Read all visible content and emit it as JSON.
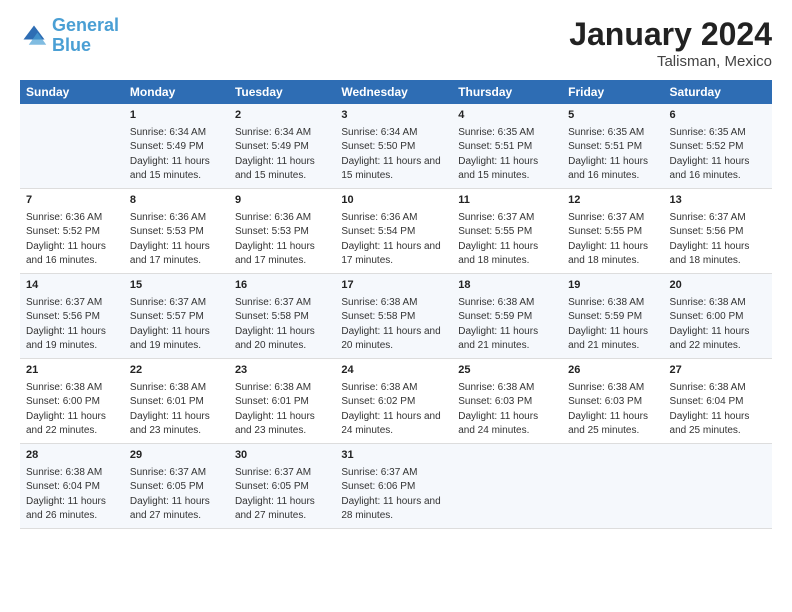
{
  "logo": {
    "line1": "General",
    "line2": "Blue"
  },
  "title": "January 2024",
  "subtitle": "Talisman, Mexico",
  "headers": [
    "Sunday",
    "Monday",
    "Tuesday",
    "Wednesday",
    "Thursday",
    "Friday",
    "Saturday"
  ],
  "rows": [
    [
      {
        "day": "",
        "sunrise": "",
        "sunset": "",
        "daylight": ""
      },
      {
        "day": "1",
        "sunrise": "Sunrise: 6:34 AM",
        "sunset": "Sunset: 5:49 PM",
        "daylight": "Daylight: 11 hours and 15 minutes."
      },
      {
        "day": "2",
        "sunrise": "Sunrise: 6:34 AM",
        "sunset": "Sunset: 5:49 PM",
        "daylight": "Daylight: 11 hours and 15 minutes."
      },
      {
        "day": "3",
        "sunrise": "Sunrise: 6:34 AM",
        "sunset": "Sunset: 5:50 PM",
        "daylight": "Daylight: 11 hours and 15 minutes."
      },
      {
        "day": "4",
        "sunrise": "Sunrise: 6:35 AM",
        "sunset": "Sunset: 5:51 PM",
        "daylight": "Daylight: 11 hours and 15 minutes."
      },
      {
        "day": "5",
        "sunrise": "Sunrise: 6:35 AM",
        "sunset": "Sunset: 5:51 PM",
        "daylight": "Daylight: 11 hours and 16 minutes."
      },
      {
        "day": "6",
        "sunrise": "Sunrise: 6:35 AM",
        "sunset": "Sunset: 5:52 PM",
        "daylight": "Daylight: 11 hours and 16 minutes."
      }
    ],
    [
      {
        "day": "7",
        "sunrise": "Sunrise: 6:36 AM",
        "sunset": "Sunset: 5:52 PM",
        "daylight": "Daylight: 11 hours and 16 minutes."
      },
      {
        "day": "8",
        "sunrise": "Sunrise: 6:36 AM",
        "sunset": "Sunset: 5:53 PM",
        "daylight": "Daylight: 11 hours and 17 minutes."
      },
      {
        "day": "9",
        "sunrise": "Sunrise: 6:36 AM",
        "sunset": "Sunset: 5:53 PM",
        "daylight": "Daylight: 11 hours and 17 minutes."
      },
      {
        "day": "10",
        "sunrise": "Sunrise: 6:36 AM",
        "sunset": "Sunset: 5:54 PM",
        "daylight": "Daylight: 11 hours and 17 minutes."
      },
      {
        "day": "11",
        "sunrise": "Sunrise: 6:37 AM",
        "sunset": "Sunset: 5:55 PM",
        "daylight": "Daylight: 11 hours and 18 minutes."
      },
      {
        "day": "12",
        "sunrise": "Sunrise: 6:37 AM",
        "sunset": "Sunset: 5:55 PM",
        "daylight": "Daylight: 11 hours and 18 minutes."
      },
      {
        "day": "13",
        "sunrise": "Sunrise: 6:37 AM",
        "sunset": "Sunset: 5:56 PM",
        "daylight": "Daylight: 11 hours and 18 minutes."
      }
    ],
    [
      {
        "day": "14",
        "sunrise": "Sunrise: 6:37 AM",
        "sunset": "Sunset: 5:56 PM",
        "daylight": "Daylight: 11 hours and 19 minutes."
      },
      {
        "day": "15",
        "sunrise": "Sunrise: 6:37 AM",
        "sunset": "Sunset: 5:57 PM",
        "daylight": "Daylight: 11 hours and 19 minutes."
      },
      {
        "day": "16",
        "sunrise": "Sunrise: 6:37 AM",
        "sunset": "Sunset: 5:58 PM",
        "daylight": "Daylight: 11 hours and 20 minutes."
      },
      {
        "day": "17",
        "sunrise": "Sunrise: 6:38 AM",
        "sunset": "Sunset: 5:58 PM",
        "daylight": "Daylight: 11 hours and 20 minutes."
      },
      {
        "day": "18",
        "sunrise": "Sunrise: 6:38 AM",
        "sunset": "Sunset: 5:59 PM",
        "daylight": "Daylight: 11 hours and 21 minutes."
      },
      {
        "day": "19",
        "sunrise": "Sunrise: 6:38 AM",
        "sunset": "Sunset: 5:59 PM",
        "daylight": "Daylight: 11 hours and 21 minutes."
      },
      {
        "day": "20",
        "sunrise": "Sunrise: 6:38 AM",
        "sunset": "Sunset: 6:00 PM",
        "daylight": "Daylight: 11 hours and 22 minutes."
      }
    ],
    [
      {
        "day": "21",
        "sunrise": "Sunrise: 6:38 AM",
        "sunset": "Sunset: 6:00 PM",
        "daylight": "Daylight: 11 hours and 22 minutes."
      },
      {
        "day": "22",
        "sunrise": "Sunrise: 6:38 AM",
        "sunset": "Sunset: 6:01 PM",
        "daylight": "Daylight: 11 hours and 23 minutes."
      },
      {
        "day": "23",
        "sunrise": "Sunrise: 6:38 AM",
        "sunset": "Sunset: 6:01 PM",
        "daylight": "Daylight: 11 hours and 23 minutes."
      },
      {
        "day": "24",
        "sunrise": "Sunrise: 6:38 AM",
        "sunset": "Sunset: 6:02 PM",
        "daylight": "Daylight: 11 hours and 24 minutes."
      },
      {
        "day": "25",
        "sunrise": "Sunrise: 6:38 AM",
        "sunset": "Sunset: 6:03 PM",
        "daylight": "Daylight: 11 hours and 24 minutes."
      },
      {
        "day": "26",
        "sunrise": "Sunrise: 6:38 AM",
        "sunset": "Sunset: 6:03 PM",
        "daylight": "Daylight: 11 hours and 25 minutes."
      },
      {
        "day": "27",
        "sunrise": "Sunrise: 6:38 AM",
        "sunset": "Sunset: 6:04 PM",
        "daylight": "Daylight: 11 hours and 25 minutes."
      }
    ],
    [
      {
        "day": "28",
        "sunrise": "Sunrise: 6:38 AM",
        "sunset": "Sunset: 6:04 PM",
        "daylight": "Daylight: 11 hours and 26 minutes."
      },
      {
        "day": "29",
        "sunrise": "Sunrise: 6:37 AM",
        "sunset": "Sunset: 6:05 PM",
        "daylight": "Daylight: 11 hours and 27 minutes."
      },
      {
        "day": "30",
        "sunrise": "Sunrise: 6:37 AM",
        "sunset": "Sunset: 6:05 PM",
        "daylight": "Daylight: 11 hours and 27 minutes."
      },
      {
        "day": "31",
        "sunrise": "Sunrise: 6:37 AM",
        "sunset": "Sunset: 6:06 PM",
        "daylight": "Daylight: 11 hours and 28 minutes."
      },
      {
        "day": "",
        "sunrise": "",
        "sunset": "",
        "daylight": ""
      },
      {
        "day": "",
        "sunrise": "",
        "sunset": "",
        "daylight": ""
      },
      {
        "day": "",
        "sunrise": "",
        "sunset": "",
        "daylight": ""
      }
    ]
  ]
}
